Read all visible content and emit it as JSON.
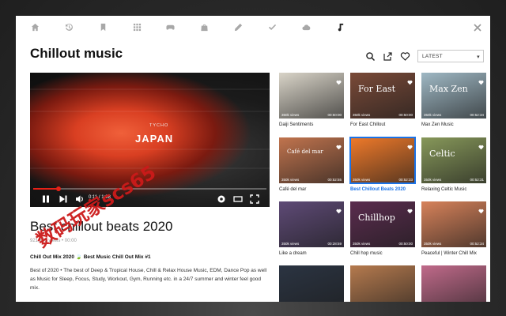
{
  "nav": {
    "icons": [
      "home-icon",
      "history-icon",
      "bookmark-icon",
      "grid-icon",
      "gamepad-icon",
      "shopping-bag-icon",
      "pen-icon",
      "check-icon",
      "cloud-icon",
      "music-note-icon"
    ],
    "active": "music-note-icon"
  },
  "header": {
    "title": "Chillout music",
    "sort_value": "LATEST"
  },
  "player": {
    "overlay_subtitle": "TYCHO",
    "overlay_title": "JAPAN",
    "time": "0:11 / 1:38",
    "progress": 0.11,
    "accent": "#e62117"
  },
  "video": {
    "title": "Best chillout beats 2020",
    "views": "921,765 views • 00:00",
    "headline": "Chill Out Mix 2020 🍃 Best Music Chill Out Mix #1",
    "description": "Best of 2020 • The best of Deep & Tropical House, Chill & Relax House Music, EDM, Dance Pop as well as Music for Sleep, Focus, Study, Workout, Gym, Running etc. in a 24/7 summer and winter feel good mix."
  },
  "grid": [
    {
      "label": "Daiji Sentiments",
      "views": "350k views",
      "duration": "00:50:00",
      "overlay": "",
      "bg": "#d9d4c8"
    },
    {
      "label": "For East Chillout",
      "views": "350k views",
      "duration": "00:50:00",
      "overlay": "For East",
      "bg": "#7a4a38"
    },
    {
      "label": "Max Zen Music",
      "views": "350k views",
      "duration": "00:52:34",
      "overlay": "Max Zen",
      "bg": "#9fb8c4"
    },
    {
      "label": "Café del mar",
      "views": "350k views",
      "duration": "00:52:55",
      "overlay": "Café del mar",
      "bg": "#c1744e"
    },
    {
      "label": "Best Chillout Beats 2020",
      "views": "350k views",
      "duration": "00:52:33",
      "overlay": "",
      "bg": "#f07a2a",
      "selected": true
    },
    {
      "label": "Relaxing Celtic Music",
      "views": "350k views",
      "duration": "00:52:31",
      "overlay": "Celtic",
      "bg": "#87985a"
    },
    {
      "label": "Like a dream",
      "views": "350k views",
      "duration": "00:28:59",
      "overlay": "",
      "bg": "#5e4a76"
    },
    {
      "label": "Chill hop music",
      "views": "350k views",
      "duration": "00:50:00",
      "overlay": "Chillhop",
      "bg": "#5a2c4e"
    },
    {
      "label": "Peaceful | Winter Chill Mix",
      "views": "350k views",
      "duration": "00:52:34",
      "overlay": "",
      "bg": "#d7825a"
    },
    {
      "label": "",
      "views": "",
      "duration": "",
      "overlay": "",
      "bg": "#2b3442"
    },
    {
      "label": "",
      "views": "",
      "duration": "",
      "overlay": "",
      "bg": "#b57a4e"
    },
    {
      "label": "",
      "views": "",
      "duration": "",
      "overlay": "",
      "bg": "#c06a8a"
    }
  ],
  "watermark": "数码玩家scs65"
}
